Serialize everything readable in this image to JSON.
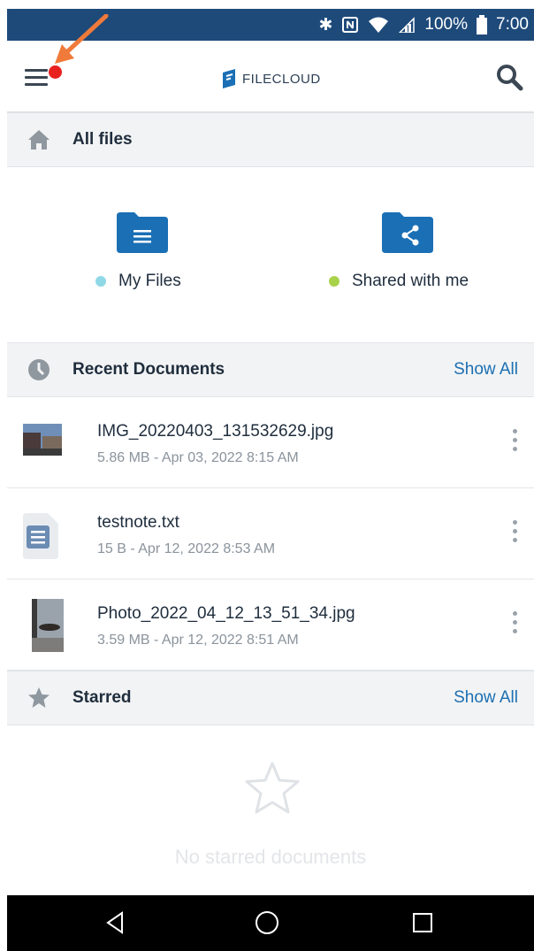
{
  "status_bar": {
    "battery": "100%",
    "time": "7:00"
  },
  "app_bar": {
    "logo_text": "FILECLOUD"
  },
  "all_files": {
    "title": "All files"
  },
  "folders": [
    {
      "label": "My Files",
      "dot_color": "#8fd9e6",
      "icon": "folder-document-icon"
    },
    {
      "label": "Shared with me",
      "dot_color": "#a9d24b",
      "icon": "folder-share-icon"
    }
  ],
  "recent": {
    "title": "Recent Documents",
    "show_all": "Show All",
    "items": [
      {
        "name": "IMG_20220403_131532629.jpg",
        "meta": "5.86 MB - Apr 03, 2022 8:15 AM",
        "thumb": "photo-thumbnail"
      },
      {
        "name": "testnote.txt",
        "meta": "15 B - Apr 12, 2022 8:53 AM",
        "thumb": "text-file-icon"
      },
      {
        "name": "Photo_2022_04_12_13_51_34.jpg",
        "meta": "3.59 MB - Apr 12, 2022 8:51 AM",
        "thumb": "photo-thumbnail"
      }
    ]
  },
  "starred": {
    "title": "Starred",
    "show_all": "Show All",
    "empty_text": "No starred documents"
  },
  "colors": {
    "status_bar": "#1e4a7a",
    "accent": "#1b6fb3",
    "folder": "#1a6fb5",
    "notification": "#e8201e"
  }
}
